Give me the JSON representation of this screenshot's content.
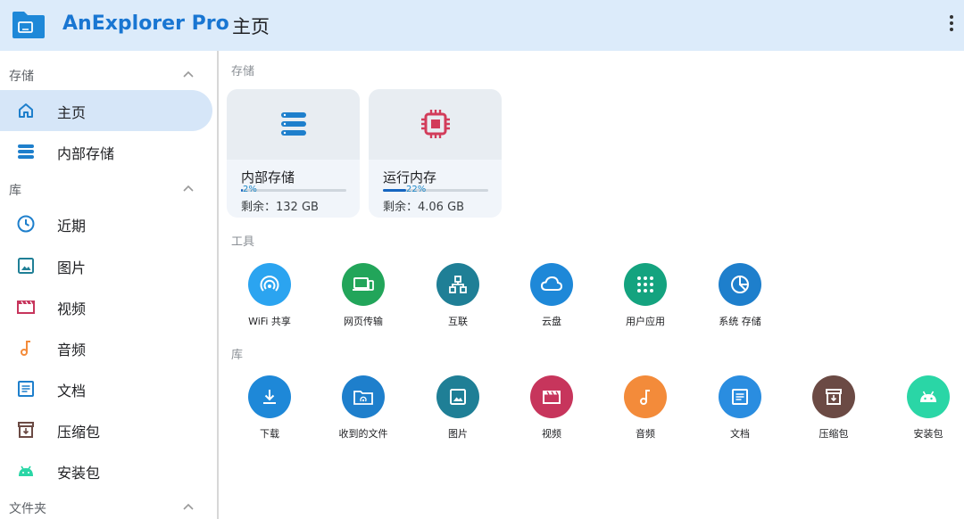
{
  "app": {
    "name": "AnExplorer Pro",
    "page_title": "主页"
  },
  "sidebar": {
    "sections": {
      "storage": "存储",
      "library": "库",
      "folders": "文件夹"
    },
    "items": [
      {
        "label": "主页",
        "icon": "home-icon",
        "active": true
      },
      {
        "label": "内部存储",
        "icon": "storage-icon"
      },
      {
        "label": "近期",
        "icon": "clock-icon"
      },
      {
        "label": "图片",
        "icon": "image-icon"
      },
      {
        "label": "视频",
        "icon": "video-icon"
      },
      {
        "label": "音频",
        "icon": "music-icon"
      },
      {
        "label": "文档",
        "icon": "document-icon"
      },
      {
        "label": "压缩包",
        "icon": "archive-icon"
      },
      {
        "label": "安装包",
        "icon": "android-icon"
      }
    ]
  },
  "main": {
    "storage_label": "存储",
    "tools_label": "工具",
    "library_label": "库",
    "cards": [
      {
        "title": "内部存储",
        "percent": "2%",
        "percent_value": 2,
        "free": "剩余：132 GB",
        "icon": "storage-icon"
      },
      {
        "title": "运行内存",
        "percent": "22%",
        "percent_value": 22,
        "free": "剩余：4.06 GB",
        "icon": "chip-icon"
      }
    ],
    "tools": [
      {
        "label": "WiFi 共享",
        "icon": "wifi-share-icon",
        "color": "#2ba4f0"
      },
      {
        "label": "网页传输",
        "icon": "web-transfer-icon",
        "color": "#22a55a"
      },
      {
        "label": "互联",
        "icon": "network-icon",
        "color": "#1f7f96"
      },
      {
        "label": "云盘",
        "icon": "cloud-icon",
        "color": "#1e88d8"
      },
      {
        "label": "用户应用",
        "icon": "apps-icon",
        "color": "#14a37f"
      },
      {
        "label": "系统 存储",
        "icon": "pie-chart-icon",
        "color": "#1e7fcc"
      }
    ],
    "library": [
      {
        "label": "下载",
        "icon": "download-icon",
        "color": "#1e88d8"
      },
      {
        "label": "收到的文件",
        "icon": "received-files-icon",
        "color": "#1e7fcc"
      },
      {
        "label": "图片",
        "icon": "image-icon",
        "color": "#1f7f96"
      },
      {
        "label": "视频",
        "icon": "video-icon",
        "color": "#c7355c"
      },
      {
        "label": "音频",
        "icon": "music-icon",
        "color": "#f38b3a"
      },
      {
        "label": "文档",
        "icon": "document-icon",
        "color": "#2a8de0"
      },
      {
        "label": "压缩包",
        "icon": "archive-icon",
        "color": "#6b4a44"
      },
      {
        "label": "安装包",
        "icon": "android-icon",
        "color": "#2ad6a6"
      }
    ]
  }
}
